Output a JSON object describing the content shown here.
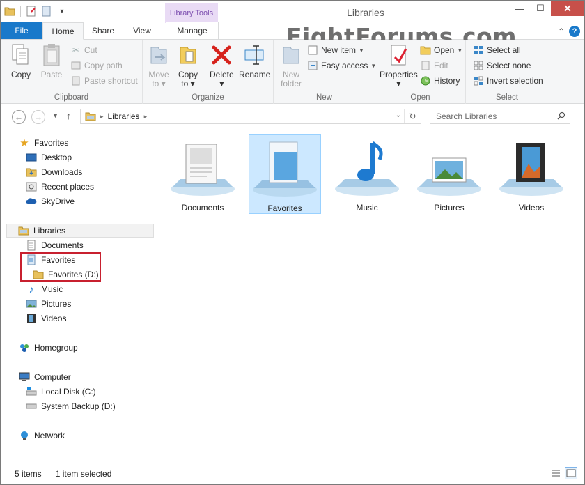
{
  "window": {
    "title": "Libraries",
    "context_tab": "Library Tools",
    "watermark": "EightForums.com",
    "buttons": [
      "—",
      "☐",
      "✕"
    ]
  },
  "tabs": {
    "file": "File",
    "home": "Home",
    "share": "Share",
    "view": "View",
    "manage": "Manage"
  },
  "ribbon": {
    "clipboard": {
      "label": "Clipboard",
      "copy": "Copy",
      "paste": "Paste",
      "cut": "Cut",
      "copy_path": "Copy path",
      "paste_shortcut": "Paste shortcut"
    },
    "organize": {
      "label": "Organize",
      "move_to": "Move\nto",
      "copy_to": "Copy\nto",
      "delete": "Delete",
      "rename": "Rename"
    },
    "new": {
      "label": "New",
      "new_folder": "New\nfolder",
      "new_item": "New item",
      "easy_access": "Easy access"
    },
    "open": {
      "label": "Open",
      "properties": "Properties",
      "open": "Open",
      "edit": "Edit",
      "history": "History"
    },
    "select": {
      "label": "Select",
      "select_all": "Select all",
      "select_none": "Select none",
      "invert_selection": "Invert selection"
    }
  },
  "address": {
    "crumb": "Libraries",
    "search_placeholder": "Search Libraries"
  },
  "nav": {
    "favorites": "Favorites",
    "desktop": "Desktop",
    "downloads": "Downloads",
    "recent_places": "Recent places",
    "skydrive": "SkyDrive",
    "libraries": "Libraries",
    "documents": "Documents",
    "lib_favorites": "Favorites",
    "favorites_d": "Favorites (D:)",
    "music": "Music",
    "pictures": "Pictures",
    "videos": "Videos",
    "homegroup": "Homegroup",
    "computer": "Computer",
    "local_disk": "Local Disk (C:)",
    "system_backup": "System Backup (D:)",
    "network": "Network"
  },
  "libraries": [
    {
      "name": "Documents"
    },
    {
      "name": "Favorites"
    },
    {
      "name": "Music"
    },
    {
      "name": "Pictures"
    },
    {
      "name": "Videos"
    }
  ],
  "status": {
    "items": "5 items",
    "selected": "1 item selected"
  },
  "colors": {
    "accent": "#1979ca",
    "selection": "#cce8ff",
    "highlight_box": "#c8202f",
    "close_button": "#c7504a"
  }
}
